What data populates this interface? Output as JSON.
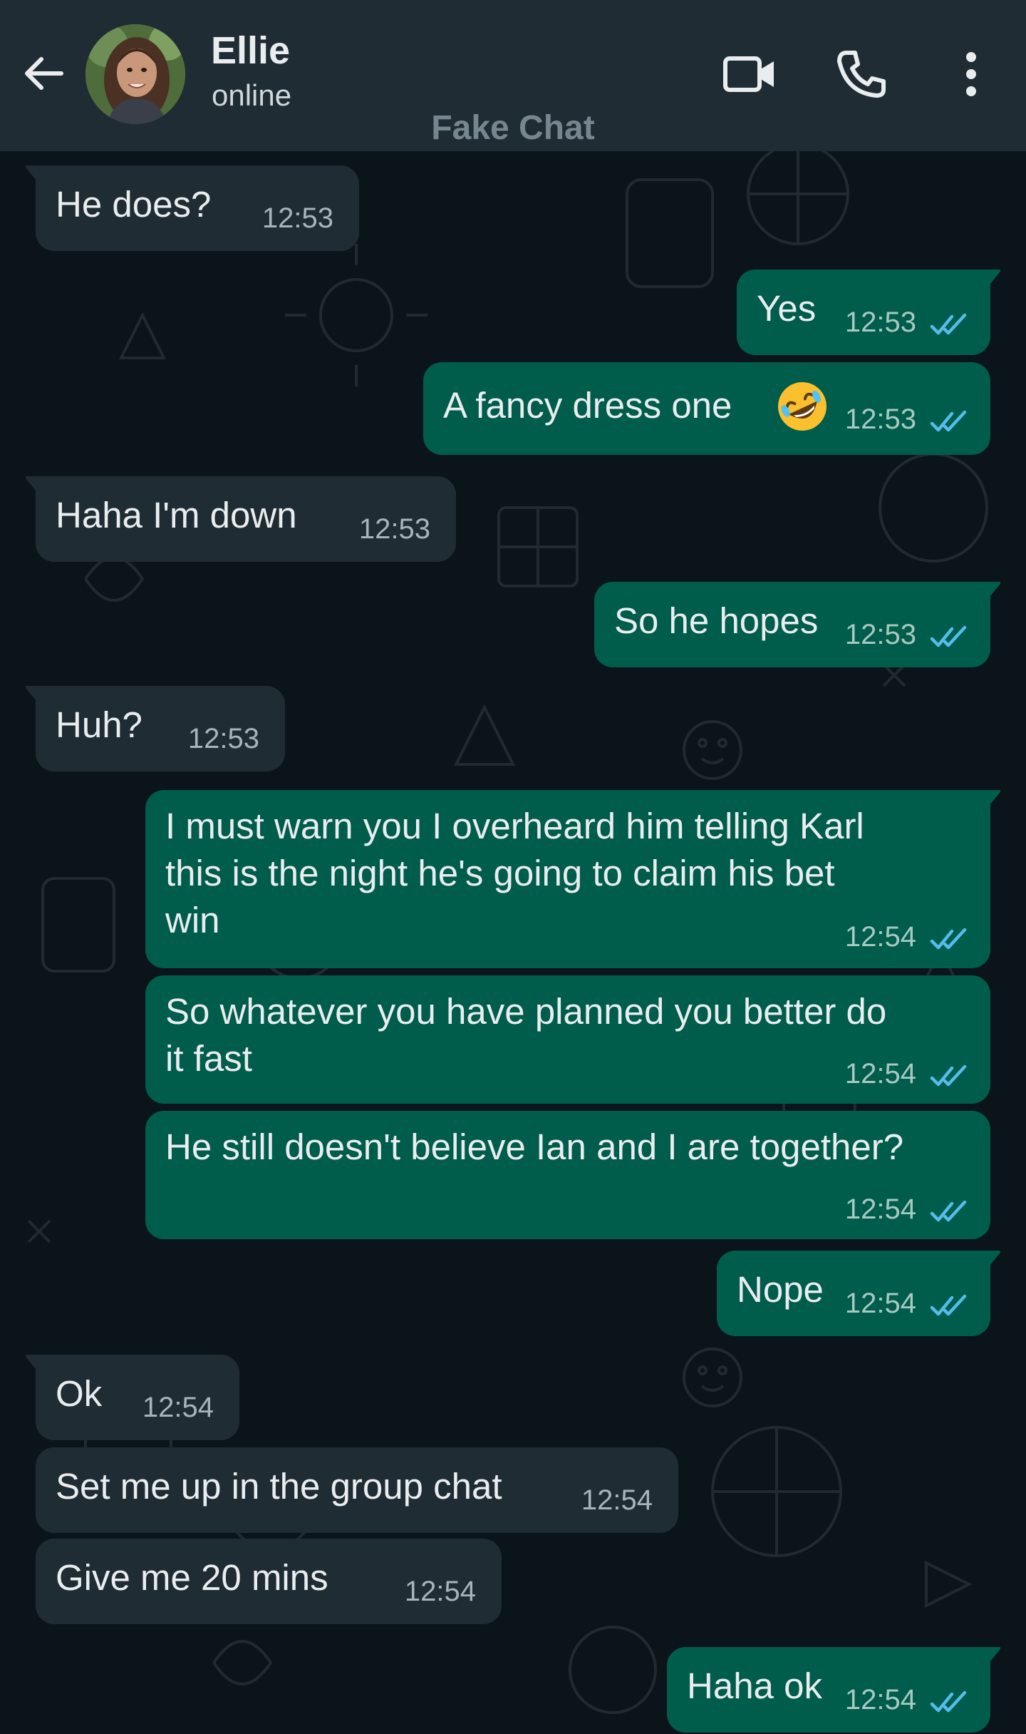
{
  "header": {
    "contact_name": "Ellie",
    "contact_status": "online",
    "watermark": "Fake Chat",
    "icons": [
      "back-arrow-icon",
      "avatar",
      "video-call-icon",
      "phone-icon",
      "more-vert-icon"
    ]
  },
  "colors": {
    "header_bg": "#1f2c34",
    "chat_bg": "#0b141a",
    "incoming_bubble": "#202c33",
    "outgoing_bubble": "#005c4b",
    "read_ticks": "#53bdeb"
  },
  "messages": [
    {
      "direction": "in",
      "text": "He does?",
      "time": "12:53"
    },
    {
      "direction": "out",
      "text": "Yes",
      "time": "12:53",
      "status": "read"
    },
    {
      "direction": "out",
      "text": "A fancy dress one",
      "emoji": "rolling-on-floor-laughing-emoji",
      "time": "12:53",
      "status": "read"
    },
    {
      "direction": "in",
      "text": "Haha I'm down",
      "time": "12:53"
    },
    {
      "direction": "out",
      "text": "So he hopes",
      "time": "12:53",
      "status": "read"
    },
    {
      "direction": "in",
      "text": "Huh?",
      "time": "12:53"
    },
    {
      "direction": "out",
      "text": "I must warn you I overheard him telling Karl\nthis is the night he's going to claim his bet\nwin",
      "time": "12:54",
      "status": "read"
    },
    {
      "direction": "out",
      "text": "So whatever you have planned you better do\nit fast",
      "time": "12:54",
      "status": "read"
    },
    {
      "direction": "out",
      "text": "He still doesn't believe Ian and I are together?",
      "time": "12:54",
      "status": "read"
    },
    {
      "direction": "out",
      "text": "Nope",
      "time": "12:54",
      "status": "read"
    },
    {
      "direction": "in",
      "text": "Ok",
      "time": "12:54"
    },
    {
      "direction": "in",
      "text": "Set me up in the group chat",
      "time": "12:54"
    },
    {
      "direction": "in",
      "text": "Give me 20 mins",
      "time": "12:54"
    },
    {
      "direction": "out",
      "text": "Haha ok",
      "time": "12:54",
      "status": "read"
    }
  ]
}
